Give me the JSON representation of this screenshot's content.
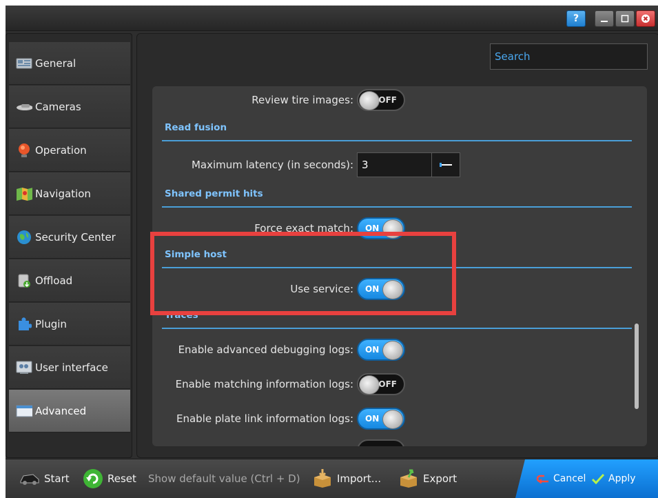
{
  "window": {
    "help_label": "?"
  },
  "search": {
    "placeholder": "Search"
  },
  "sidebar": {
    "items": [
      {
        "label": "General",
        "icon": "general-icon"
      },
      {
        "label": "Cameras",
        "icon": "camera-icon"
      },
      {
        "label": "Operation",
        "icon": "operation-icon"
      },
      {
        "label": "Navigation",
        "icon": "map-icon"
      },
      {
        "label": "Security Center",
        "icon": "globe-icon"
      },
      {
        "label": "Offload",
        "icon": "offload-icon"
      },
      {
        "label": "Plugin",
        "icon": "puzzle-icon"
      },
      {
        "label": "User interface",
        "icon": "user-interface-icon"
      },
      {
        "label": "Advanced",
        "icon": "window-icon",
        "active": true
      }
    ]
  },
  "settings": {
    "review_tire": {
      "label": "Review tire images:",
      "state": "OFF"
    },
    "read_fusion": {
      "title": "Read fusion"
    },
    "max_latency": {
      "label": "Maximum latency (in seconds):",
      "value": "3"
    },
    "shared_permit": {
      "title": "Shared permit hits"
    },
    "force_exact": {
      "label": "Force exact match:",
      "state": "ON"
    },
    "simple_host": {
      "title": "Simple host"
    },
    "use_service": {
      "label": "Use service:",
      "state": "ON"
    },
    "traces": {
      "title": "Traces"
    },
    "debug_logs": {
      "label": "Enable advanced debugging logs:",
      "state": "ON"
    },
    "matching_logs": {
      "label": "Enable matching information logs:",
      "state": "OFF"
    },
    "plate_link_logs": {
      "label": "Enable plate link information logs:",
      "state": "ON"
    }
  },
  "footer": {
    "start": "Start",
    "reset": "Reset",
    "hint": "Show default value (Ctrl + D)",
    "import": "Import...",
    "export": "Export",
    "cancel": "Cancel",
    "apply": "Apply"
  },
  "colors": {
    "accent": "#1f8fe8",
    "highlight": "#e8413f",
    "section_title": "#7fc4ff"
  }
}
